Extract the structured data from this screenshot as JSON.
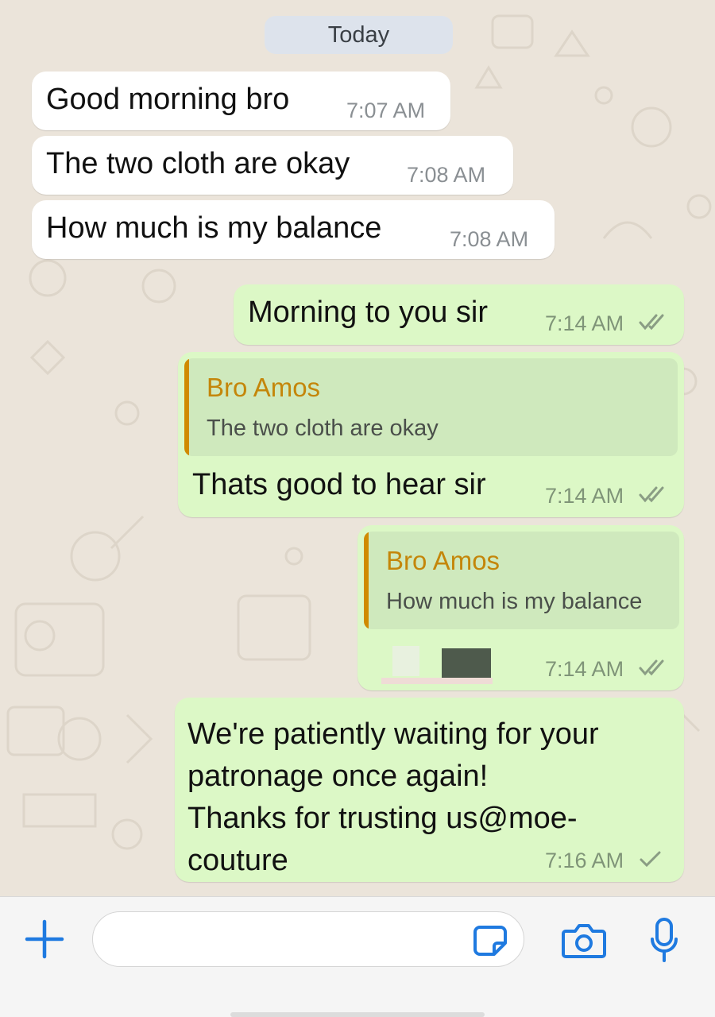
{
  "chat": {
    "date_divider": "Today",
    "messages": [
      {
        "direction": "incoming",
        "text": "Good morning bro",
        "time": "7:07 AM"
      },
      {
        "direction": "incoming",
        "text": "The two cloth are okay",
        "time": "7:08 AM"
      },
      {
        "direction": "incoming",
        "text": "How much is my balance",
        "time": "7:08 AM"
      },
      {
        "direction": "outgoing",
        "text": "Morning to you sir",
        "time": "7:14 AM",
        "status": "read"
      },
      {
        "direction": "outgoing",
        "reply_to": {
          "name": "Bro Amos",
          "text": "The two cloth are okay"
        },
        "text": "Thats good to hear sir",
        "time": "7:14 AM",
        "status": "read"
      },
      {
        "direction": "outgoing",
        "reply_to": {
          "name": "Bro Amos",
          "text": "How much is my balance"
        },
        "text": "",
        "redacted": true,
        "time": "7:14 AM",
        "status": "read"
      },
      {
        "direction": "outgoing",
        "lines": [
          "We're patiently waiting for your",
          "patronage once again!",
          "Thanks for trusting us@moe-",
          "couture"
        ],
        "time": "7:16 AM",
        "status": "sent"
      }
    ]
  },
  "input_bar": {
    "icons": [
      "plus-icon",
      "sticker-icon",
      "camera-icon",
      "microphone-icon"
    ],
    "value": "",
    "accent_color": "#1f7ae0"
  },
  "colors": {
    "wallpaper": "#ebe4da",
    "incoming_bubble": "#ffffff",
    "outgoing_bubble": "#dcf8c6",
    "quote_background": "#cfe9bd",
    "quote_accent": "#d08a00",
    "read_tick": "#8a9d84"
  }
}
